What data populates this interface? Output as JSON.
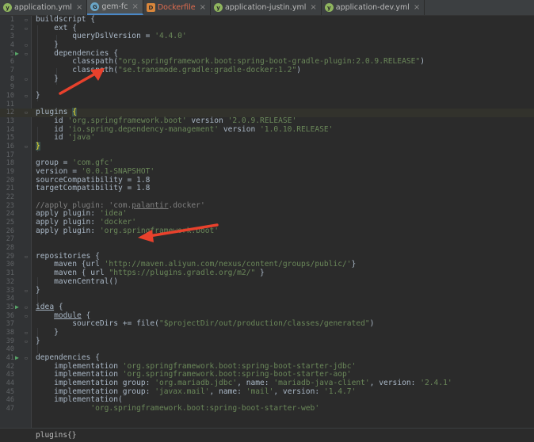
{
  "tabs": [
    {
      "label": "application.yml",
      "icon": "yml",
      "active": false
    },
    {
      "label": "gem-fc",
      "icon": "gradle",
      "active": true
    },
    {
      "label": "Dockerfile",
      "icon": "docker",
      "active": false
    },
    {
      "label": "application-justin.yml",
      "icon": "yml",
      "active": false
    },
    {
      "label": "application-dev.yml",
      "icon": "yml",
      "active": false
    }
  ],
  "code_lines": [
    {
      "n": "1",
      "html": "buildscript {"
    },
    {
      "n": "2",
      "html": "    ext {"
    },
    {
      "n": "3",
      "html": "        queryDslVersion = <span class=\"str\">'4.4.0'</span>"
    },
    {
      "n": "4",
      "html": "    }"
    },
    {
      "n": "5",
      "html": "    dependencies {",
      "run": true
    },
    {
      "n": "6",
      "html": "        classpath(<span class=\"str\">\"org.springframework.boot:spring-boot-gradle-plugin:2.0.9.RELEASE\"</span>)"
    },
    {
      "n": "7",
      "html": "        classpath(<span class=\"str\">\"se.transmode.gradle:gradle-docker:1.2\"</span>)"
    },
    {
      "n": "8",
      "html": "    }"
    },
    {
      "n": "9",
      "html": ""
    },
    {
      "n": "10",
      "html": "}"
    },
    {
      "n": "11",
      "html": ""
    },
    {
      "n": "12",
      "html": "plugins <span class=\"bracket-match\">{</span>",
      "hl": true
    },
    {
      "n": "13",
      "html": "    id <span class=\"str\">'org.springframework.boot'</span> version <span class=\"str\">'2.0.9.RELEASE'</span>"
    },
    {
      "n": "14",
      "html": "    id <span class=\"str\">'io.spring.dependency-management'</span> version <span class=\"str\">'1.0.10.RELEASE'</span>"
    },
    {
      "n": "15",
      "html": "    id <span class=\"str\">'java'</span>"
    },
    {
      "n": "16",
      "html": "<span class=\"bracket-match\">}</span>"
    },
    {
      "n": "17",
      "html": ""
    },
    {
      "n": "18",
      "html": "group = <span class=\"str\">'com.gfc'</span>"
    },
    {
      "n": "19",
      "html": "version = <span class=\"str\">'0.0.1-SNAPSHOT'</span>"
    },
    {
      "n": "20",
      "html": "sourceCompatibility = 1.8"
    },
    {
      "n": "21",
      "html": "targetCompatibility = 1.8"
    },
    {
      "n": "22",
      "html": ""
    },
    {
      "n": "23",
      "html": "<span class=\"cm\">//apply plugin: 'com.<u>palantir</u>.docker'</span>"
    },
    {
      "n": "24",
      "html": "apply plugin: <span class=\"str\">'idea'</span>"
    },
    {
      "n": "25",
      "html": "apply plugin: <span class=\"str\">'docker'</span>"
    },
    {
      "n": "26",
      "html": "apply plugin: <span class=\"str\">'org.springframework.boot'</span>"
    },
    {
      "n": "27",
      "html": ""
    },
    {
      "n": "28",
      "html": ""
    },
    {
      "n": "29",
      "html": "repositories {"
    },
    {
      "n": "30",
      "html": "    maven {url <span class=\"str\">'http://maven.aliyun.com/nexus/content/groups/public/'</span>}"
    },
    {
      "n": "31",
      "html": "    maven { url <span class=\"str\">\"https://plugins.gradle.org/m2/\"</span> }"
    },
    {
      "n": "32",
      "html": "    mavenCentral()"
    },
    {
      "n": "33",
      "html": "}"
    },
    {
      "n": "34",
      "html": ""
    },
    {
      "n": "35",
      "html": "<u>idea</u> {",
      "run": true
    },
    {
      "n": "36",
      "html": "    <u>module</u> {"
    },
    {
      "n": "37",
      "html": "        sourceDirs += file(<span class=\"str\">\"$projectDir/out/production/classes/generated\"</span>)"
    },
    {
      "n": "38",
      "html": "    }"
    },
    {
      "n": "39",
      "html": "}"
    },
    {
      "n": "40",
      "html": ""
    },
    {
      "n": "41",
      "html": "dependencies {",
      "run": true
    },
    {
      "n": "42",
      "html": "    implementation <span class=\"str\">'org.springframework.boot:spring-boot-starter-jdbc'</span>"
    },
    {
      "n": "43",
      "html": "    implementation <span class=\"str\">'org.springframework.boot:spring-boot-starter-aop'</span>"
    },
    {
      "n": "44",
      "html": "    implementation group: <span class=\"str\">'org.mariadb.jdbc'</span>, name: <span class=\"str\">'mariadb-java-client'</span>, version: <span class=\"str\">'2.4.1'</span>"
    },
    {
      "n": "45",
      "html": "    implementation group: <span class=\"str\">'javax.mail'</span>, name: <span class=\"str\">'mail'</span>, version: <span class=\"str\">'1.4.7'</span>"
    },
    {
      "n": "46",
      "html": "    implementation("
    },
    {
      "n": "47",
      "html": "            <span class=\"str\">'org.springframework.boot:spring-boot-starter-web'</span>"
    }
  ],
  "statusbar": {
    "breadcrumb": "plugins{}"
  },
  "annotation_color": "#e8412c"
}
